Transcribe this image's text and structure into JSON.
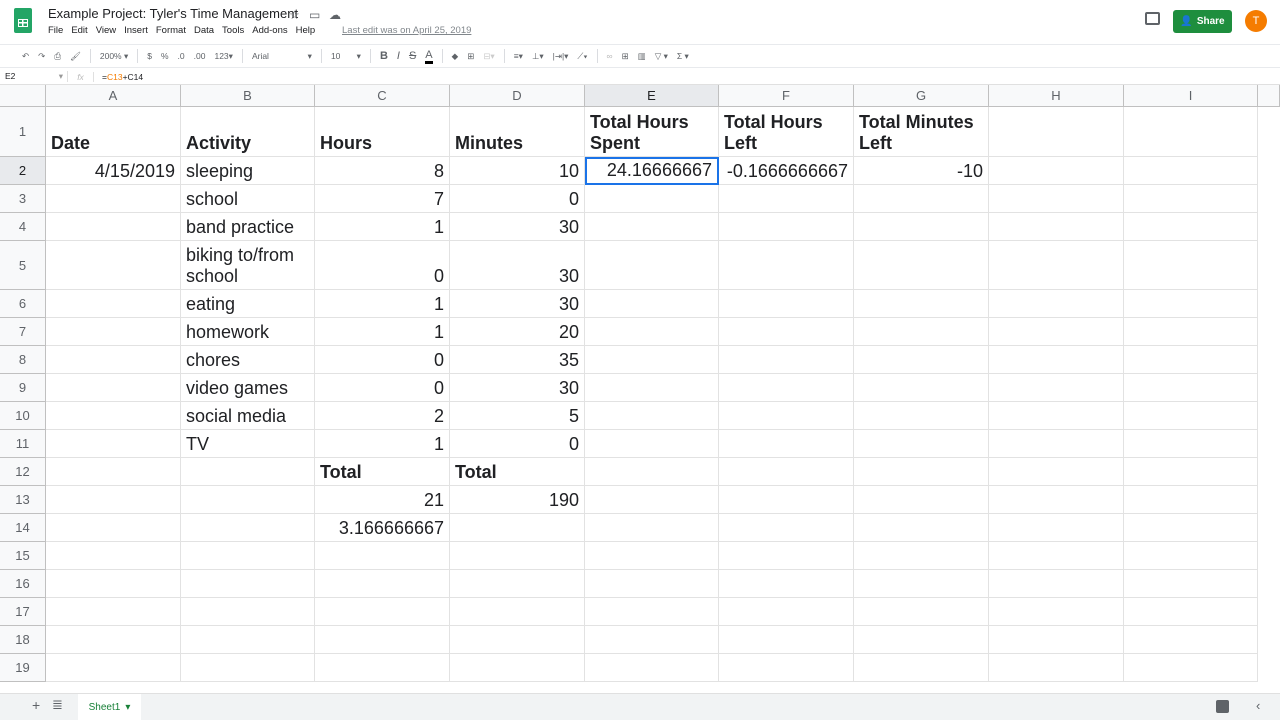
{
  "doc": {
    "title": "Example Project: Tyler's Time Management",
    "last_edit": "Last edit was on April 25, 2019",
    "share_label": "Share",
    "avatar_initial": "T"
  },
  "menu": [
    "File",
    "Edit",
    "View",
    "Insert",
    "Format",
    "Data",
    "Tools",
    "Add-ons",
    "Help"
  ],
  "toolbar": {
    "zoom": "200%",
    "currency": "$",
    "percent": "%",
    "dec_less": ".0",
    "dec_more": ".00",
    "format": "123",
    "font": "Arial",
    "font_size": "10",
    "bold": "B",
    "italic": "I",
    "strike": "S",
    "text_color": "A"
  },
  "formula_bar": {
    "name_box": "E2",
    "fx": "fx",
    "formula_ref1": "C13",
    "formula_rest": "+C14"
  },
  "columns": [
    "A",
    "B",
    "C",
    "D",
    "E",
    "F",
    "G",
    "H",
    "I"
  ],
  "rows": [
    [
      "Date",
      "Activity",
      "Hours",
      "Minutes",
      "Total Hours Spent",
      "Total Hours Left",
      "Total Minutes Left",
      "",
      ""
    ],
    [
      "4/15/2019",
      "sleeping",
      "8",
      "10",
      "24.16666667",
      "-0.1666666667",
      "-10",
      "",
      ""
    ],
    [
      "",
      "school",
      "7",
      "0",
      "",
      "",
      "",
      "",
      ""
    ],
    [
      "",
      "band practice",
      "1",
      "30",
      "",
      "",
      "",
      "",
      ""
    ],
    [
      "",
      "biking to/from school",
      "0",
      "30",
      "",
      "",
      "",
      "",
      ""
    ],
    [
      "",
      "eating",
      "1",
      "30",
      "",
      "",
      "",
      "",
      ""
    ],
    [
      "",
      "homework",
      "1",
      "20",
      "",
      "",
      "",
      "",
      ""
    ],
    [
      "",
      "chores",
      "0",
      "35",
      "",
      "",
      "",
      "",
      ""
    ],
    [
      "",
      "video games",
      "0",
      "30",
      "",
      "",
      "",
      "",
      ""
    ],
    [
      "",
      "social media",
      "2",
      "5",
      "",
      "",
      "",
      "",
      ""
    ],
    [
      "",
      "TV",
      "1",
      "0",
      "",
      "",
      "",
      "",
      ""
    ],
    [
      "",
      "",
      "Total",
      "Total",
      "",
      "",
      "",
      "",
      ""
    ],
    [
      "",
      "",
      "21",
      "190",
      "",
      "",
      "",
      "",
      ""
    ],
    [
      "",
      "",
      "3.166666667",
      "",
      "",
      "",
      "",
      "",
      ""
    ],
    [
      "",
      "",
      "",
      "",
      "",
      "",
      "",
      "",
      ""
    ],
    [
      "",
      "",
      "",
      "",
      "",
      "",
      "",
      "",
      ""
    ],
    [
      "",
      "",
      "",
      "",
      "",
      "",
      "",
      "",
      ""
    ],
    [
      "",
      "",
      "",
      "",
      "",
      "",
      "",
      "",
      ""
    ],
    [
      "",
      "",
      "",
      "",
      "",
      "",
      "",
      "",
      ""
    ]
  ],
  "active_cell": "E2",
  "sheet_tab": "Sheet1",
  "colors": {
    "accent": "#1a73e8",
    "share": "#1e8e3e",
    "sheet_tab": "#188038",
    "avatar": "#f57c00"
  }
}
